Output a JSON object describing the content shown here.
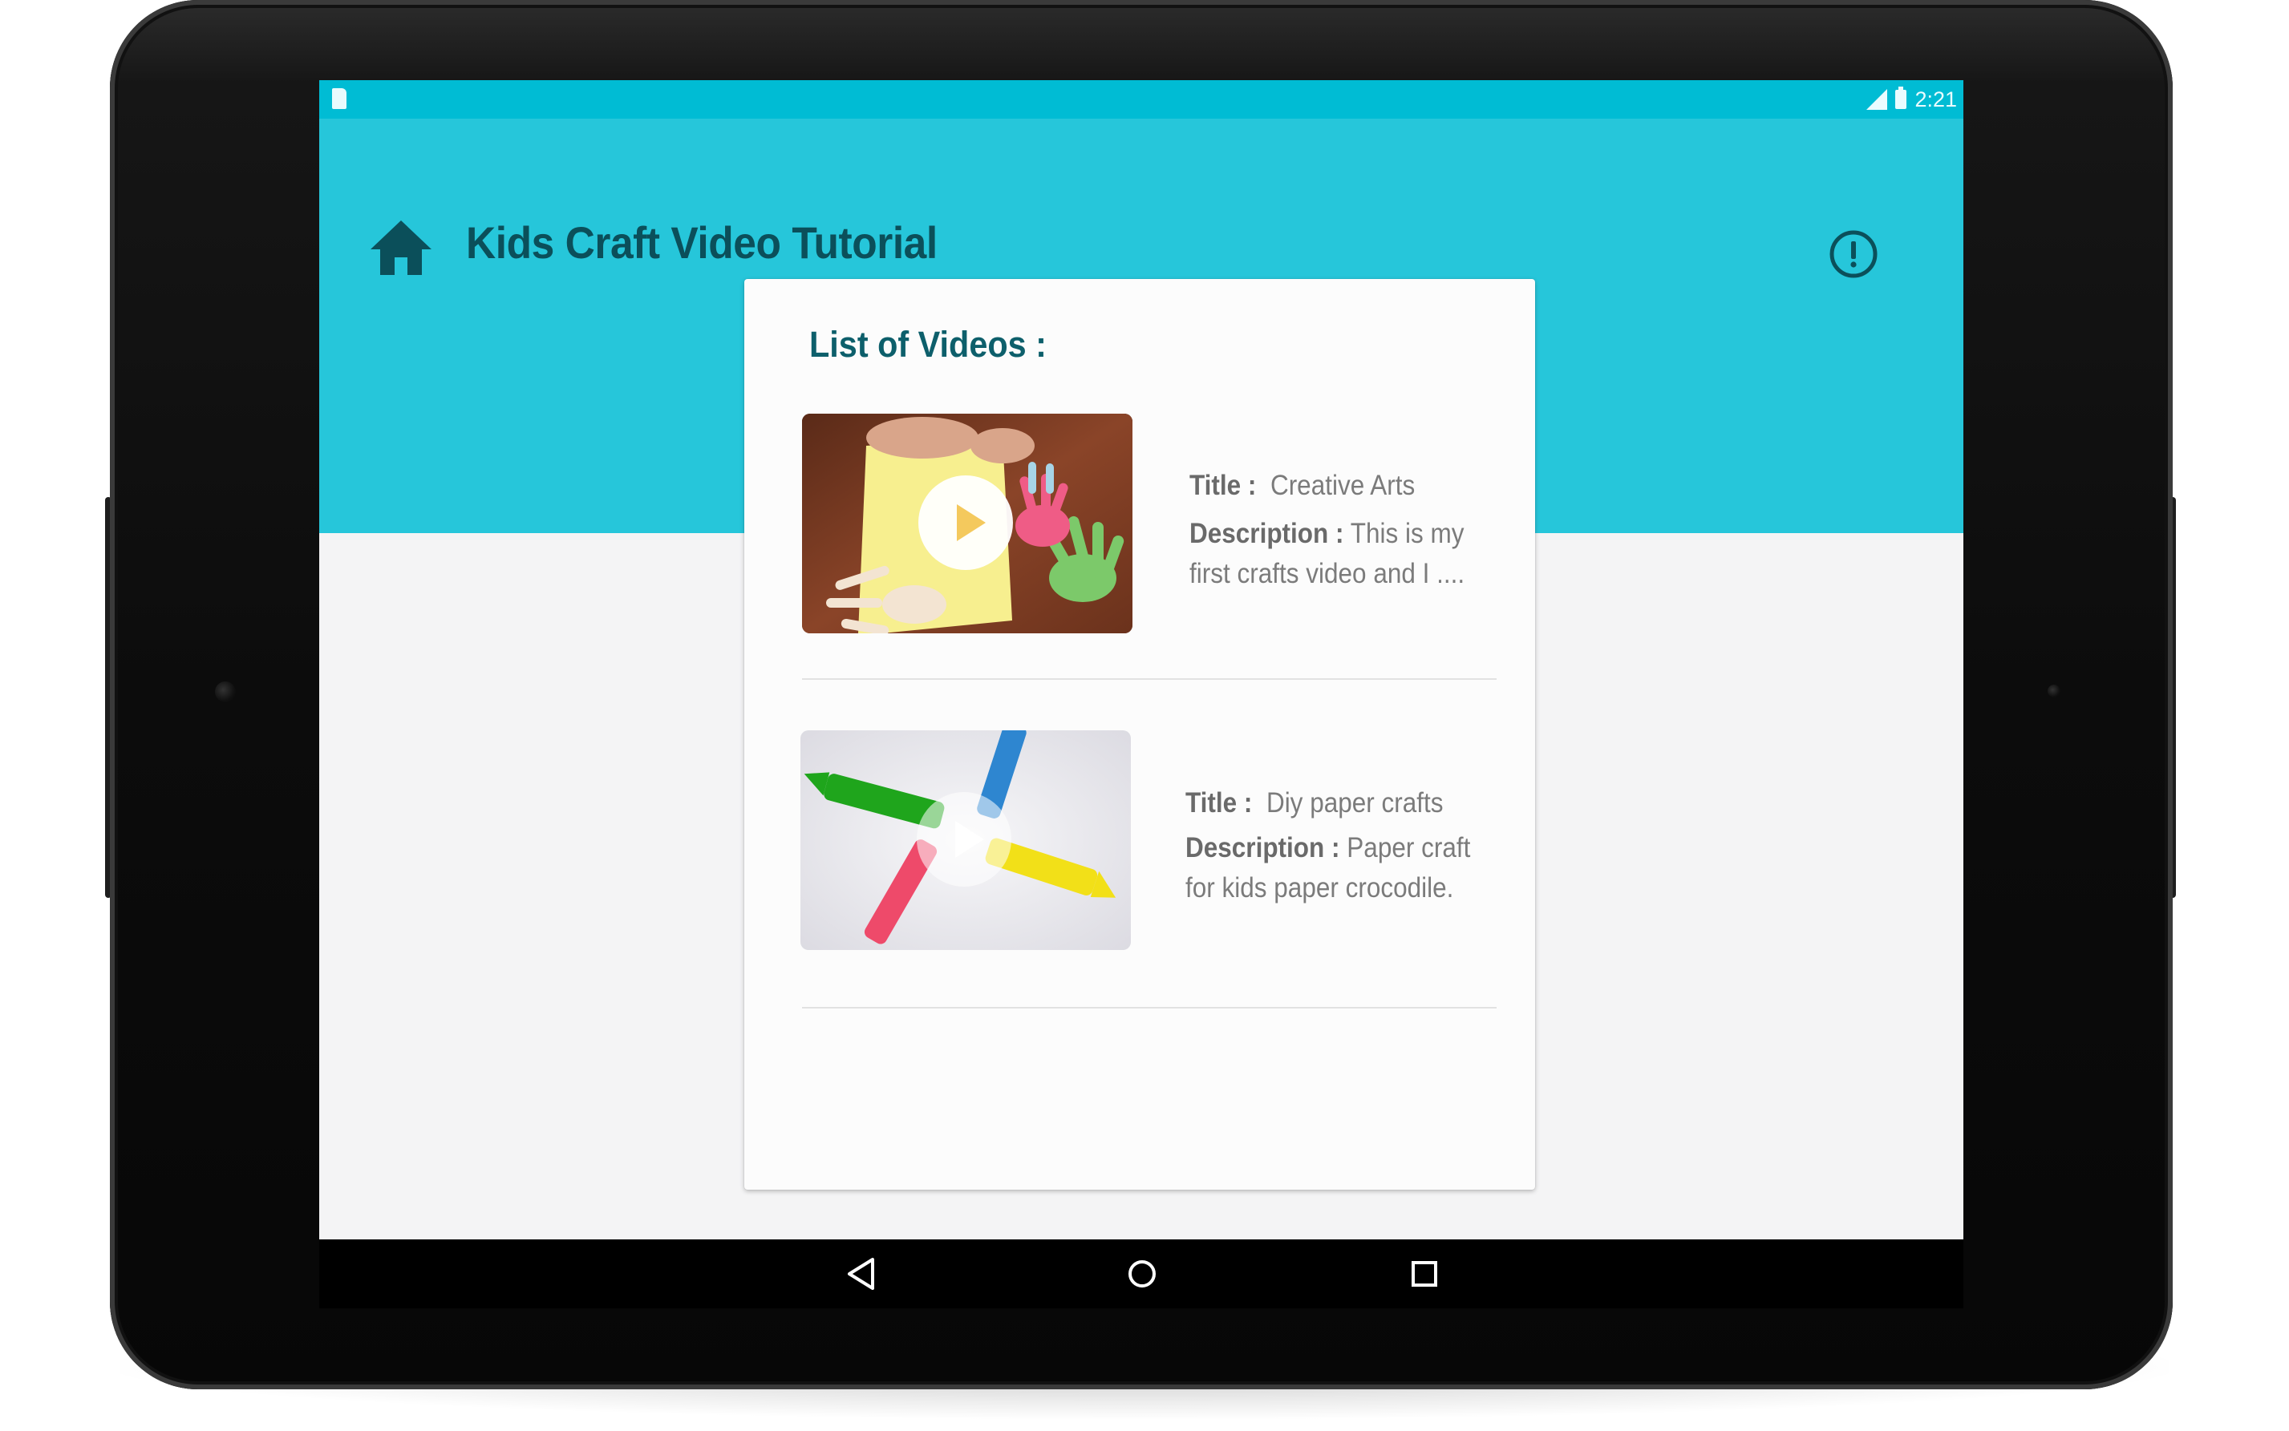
{
  "status_bar": {
    "time": "2:21",
    "icons": [
      "sd-card-icon",
      "signal-icon",
      "battery-icon"
    ]
  },
  "app_bar": {
    "title": "Kids Craft Video Tutorial",
    "home_icon": "home-icon",
    "info_icon": "info-icon"
  },
  "card": {
    "heading": "List of Videos :"
  },
  "videos": [
    {
      "title_label": "Title :",
      "title": "Creative Arts",
      "description_label": "Description :",
      "description_line1": "This is my",
      "description_line2": "first crafts video and I ...."
    },
    {
      "title_label": "Title :",
      "title": "Diy paper crafts",
      "description_label": "Description :",
      "description_line1": "Paper craft",
      "description_line2": "for kids paper crocodile."
    }
  ],
  "nav_bar": {
    "buttons": [
      "back-icon",
      "home-circle-icon",
      "recents-icon"
    ]
  },
  "colors": {
    "status_bar": "#00bcd4",
    "app_bar": "#26c6da",
    "title_text": "#0b4f5a",
    "heading_text": "#0d5f6b",
    "background": "#f4f4f5"
  }
}
